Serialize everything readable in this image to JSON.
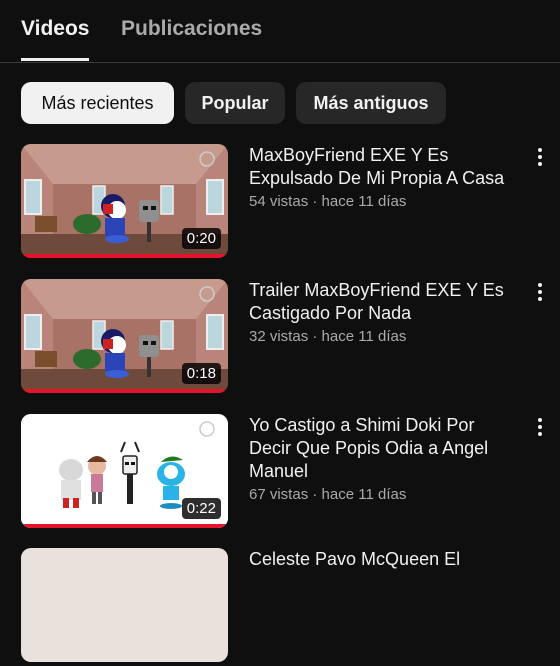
{
  "tabs": [
    {
      "label": "Videos"
    },
    {
      "label": "Publicaciones"
    }
  ],
  "chips": [
    {
      "label": "Más recientes"
    },
    {
      "label": "Popular"
    },
    {
      "label": "Más antiguos"
    }
  ],
  "videos": [
    {
      "title": "MaxBoyFriend EXE Y Es Expulsado De Mi Propia A Casa",
      "views": "54 vistas",
      "age": "hace 11 días",
      "duration": "0:20",
      "watched_fraction": 1.0
    },
    {
      "title": "Trailer MaxBoyFriend EXE Y Es Castigado Por Nada",
      "views": "32 vistas",
      "age": "hace 11 días",
      "duration": "0:18",
      "watched_fraction": 1.0
    },
    {
      "title": "Yo Castigo a Shimi Doki Por Decir Que Popis Odia a Angel Manuel",
      "views": "67 vistas",
      "age": "hace 11 días",
      "duration": "0:22",
      "watched_fraction": 1.0
    },
    {
      "title": "Celeste Pavo McQueen El",
      "views": "",
      "age": "",
      "duration": "",
      "watched_fraction": 0
    }
  ],
  "meta_separator": " · ",
  "colors": {
    "background": "#0f0f0f",
    "progress": "#e5142a",
    "chip_selected": "#f1f1f1",
    "chip": "#272727"
  },
  "icons": {
    "more": "more-vert-icon"
  }
}
